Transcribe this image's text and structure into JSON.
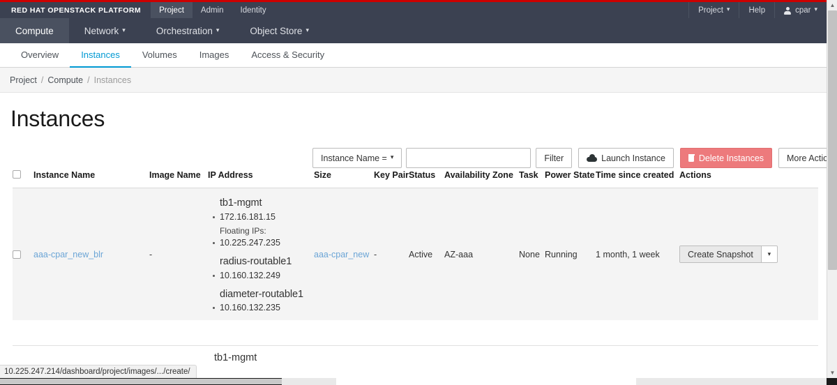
{
  "topbar": {
    "brand": "RED HAT OPENSTACK PLATFORM",
    "tabs": [
      {
        "label": "Project",
        "active": true
      },
      {
        "label": "Admin",
        "active": false
      },
      {
        "label": "Identity",
        "active": false
      }
    ],
    "right": {
      "project_label": "Project",
      "help_label": "Help",
      "user_label": "cpar"
    }
  },
  "nav2": {
    "items": [
      {
        "label": "Compute",
        "active": true,
        "caret": false
      },
      {
        "label": "Network",
        "active": false,
        "caret": true
      },
      {
        "label": "Orchestration",
        "active": false,
        "caret": true
      },
      {
        "label": "Object Store",
        "active": false,
        "caret": true
      }
    ]
  },
  "tabs3": {
    "items": [
      {
        "label": "Overview",
        "active": false
      },
      {
        "label": "Instances",
        "active": true
      },
      {
        "label": "Volumes",
        "active": false
      },
      {
        "label": "Images",
        "active": false
      },
      {
        "label": "Access & Security",
        "active": false
      }
    ]
  },
  "breadcrumb": {
    "items": [
      "Project",
      "Compute",
      "Instances"
    ],
    "separator": "/"
  },
  "page": {
    "title": "Instances"
  },
  "toolbar": {
    "filter_select": "Instance Name =",
    "filter_input_value": "",
    "filter_input_placeholder": "",
    "filter_button": "Filter",
    "launch_button": "Launch Instance",
    "delete_button": "Delete Instances",
    "more_actions_button": "More Actions"
  },
  "table": {
    "headers": [
      "Instance Name",
      "Image Name",
      "IP Address",
      "Size",
      "Key Pair",
      "Status",
      "Availability Zone",
      "Task",
      "Power State",
      "Time since created",
      "Actions"
    ],
    "rows": [
      {
        "instance_name": "aaa-cpar_new_blr",
        "image_name": "-",
        "networks": [
          {
            "name": "tb1-mgmt",
            "ips": [
              "172.16.181.15"
            ],
            "floating_label": "Floating IPs:",
            "floating_ips": [
              "10.225.247.235"
            ]
          },
          {
            "name": "radius-routable1",
            "ips": [
              "10.160.132.249"
            ]
          },
          {
            "name": "diameter-routable1",
            "ips": [
              "10.160.132.235"
            ]
          }
        ],
        "size": "aaa-cpar_new",
        "key_pair": "-",
        "status": "Active",
        "availability_zone": "AZ-aaa",
        "task": "None",
        "power_state": "Running",
        "time_since_created": "1 month, 1 week",
        "action_label": "Create Snapshot"
      }
    ],
    "next_row_partial": {
      "network_name": "tb1-mgmt"
    }
  },
  "statusbar": {
    "url": "10.225.247.214/dashboard/project/images/.../create/"
  },
  "colors": {
    "accent_red": "#cc0000",
    "header_dark": "#3b4151",
    "link_blue": "#6ba5d6",
    "tab_active_blue": "#0099d3",
    "delete_red": "#ed7a7c"
  }
}
